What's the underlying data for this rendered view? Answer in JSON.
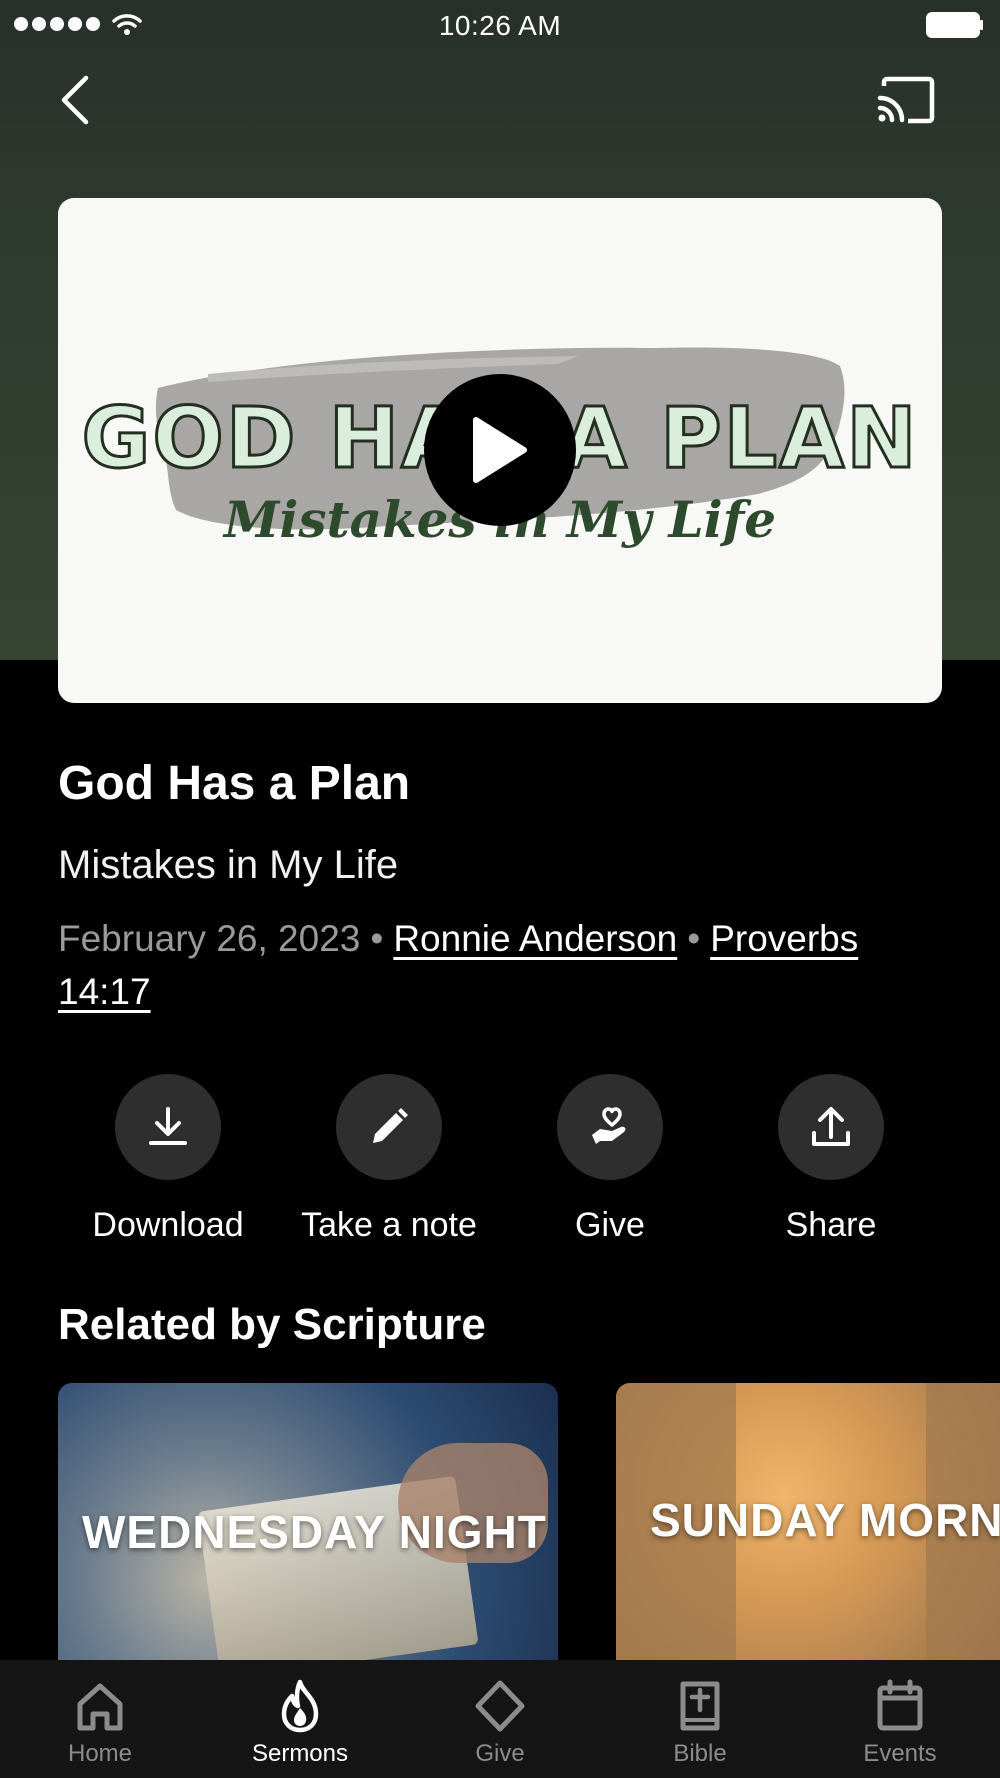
{
  "status_bar": {
    "time": "10:26 AM"
  },
  "video": {
    "thumbnail_title": "GOD HAS A PLAN",
    "thumbnail_subtitle": "Mistakes in My Life"
  },
  "sermon": {
    "title": "God Has a Plan",
    "subtitle": "Mistakes in My Life",
    "date": "February 26, 2023",
    "separator": "•",
    "speaker": "Ronnie Anderson",
    "scripture": "Proverbs 14:17"
  },
  "actions": [
    {
      "label": "Download",
      "icon": "download-icon"
    },
    {
      "label": "Take a note",
      "icon": "pencil-icon"
    },
    {
      "label": "Give",
      "icon": "heart-hand-icon"
    },
    {
      "label": "Share",
      "icon": "share-icon"
    }
  ],
  "related": {
    "heading": "Related by Scripture",
    "items": [
      {
        "title": "WEDNESDAY NIGHT"
      },
      {
        "title": "SUNDAY MORN"
      }
    ]
  },
  "tab_bar": {
    "items": [
      {
        "label": "Home",
        "icon": "home-icon",
        "active": false
      },
      {
        "label": "Sermons",
        "icon": "flame-icon",
        "active": true
      },
      {
        "label": "Give",
        "icon": "diamond-icon",
        "active": false
      },
      {
        "label": "Bible",
        "icon": "bible-icon",
        "active": false
      },
      {
        "label": "Events",
        "icon": "calendar-icon",
        "active": false
      }
    ]
  },
  "colors": {
    "header_background": "#2f3a2f",
    "page_background": "#000000",
    "action_circle": "#2e2e2e",
    "tab_bar_background": "#151515",
    "inactive_tab": "#8c8c8c"
  }
}
